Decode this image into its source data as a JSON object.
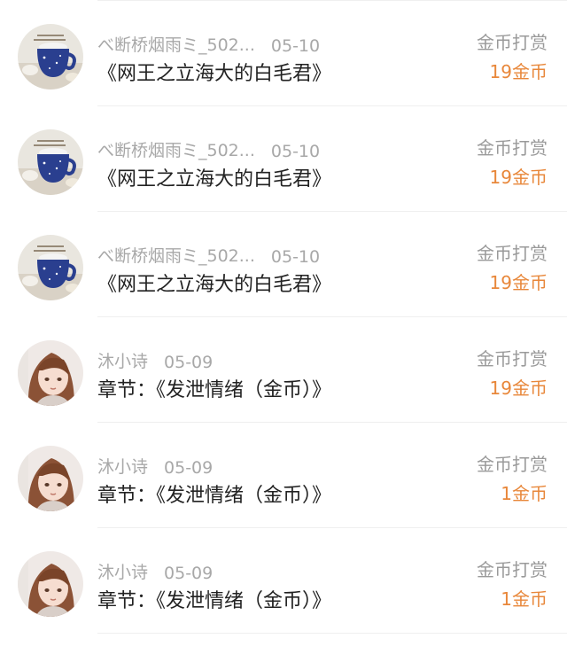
{
  "colors": {
    "amount": "#e8873a",
    "muted": "#a8a8a8",
    "title": "#222222",
    "divider": "#efefef"
  },
  "records": [
    {
      "avatar": "mug-avatar",
      "name": "べ断桥烟雨ミ_502...",
      "date": "05-10",
      "title": "《网王之立海大的白毛君》",
      "type": "金币打赏",
      "amount": "19金币"
    },
    {
      "avatar": "mug-avatar",
      "name": "べ断桥烟雨ミ_502...",
      "date": "05-10",
      "title": "《网王之立海大的白毛君》",
      "type": "金币打赏",
      "amount": "19金币"
    },
    {
      "avatar": "mug-avatar",
      "name": "べ断桥烟雨ミ_502...",
      "date": "05-10",
      "title": "《网王之立海大的白毛君》",
      "type": "金币打赏",
      "amount": "19金币"
    },
    {
      "avatar": "girl-avatar",
      "name": "沐小诗",
      "date": "05-09",
      "title": "章节：《发泄情绪（金币）》",
      "type": "金币打赏",
      "amount": "19金币"
    },
    {
      "avatar": "girl-avatar",
      "name": "沐小诗",
      "date": "05-09",
      "title": "章节：《发泄情绪（金币）》",
      "type": "金币打赏",
      "amount": "1金币"
    },
    {
      "avatar": "girl-avatar",
      "name": "沐小诗",
      "date": "05-09",
      "title": "章节：《发泄情绪（金币）》",
      "type": "金币打赏",
      "amount": "1金币"
    }
  ]
}
